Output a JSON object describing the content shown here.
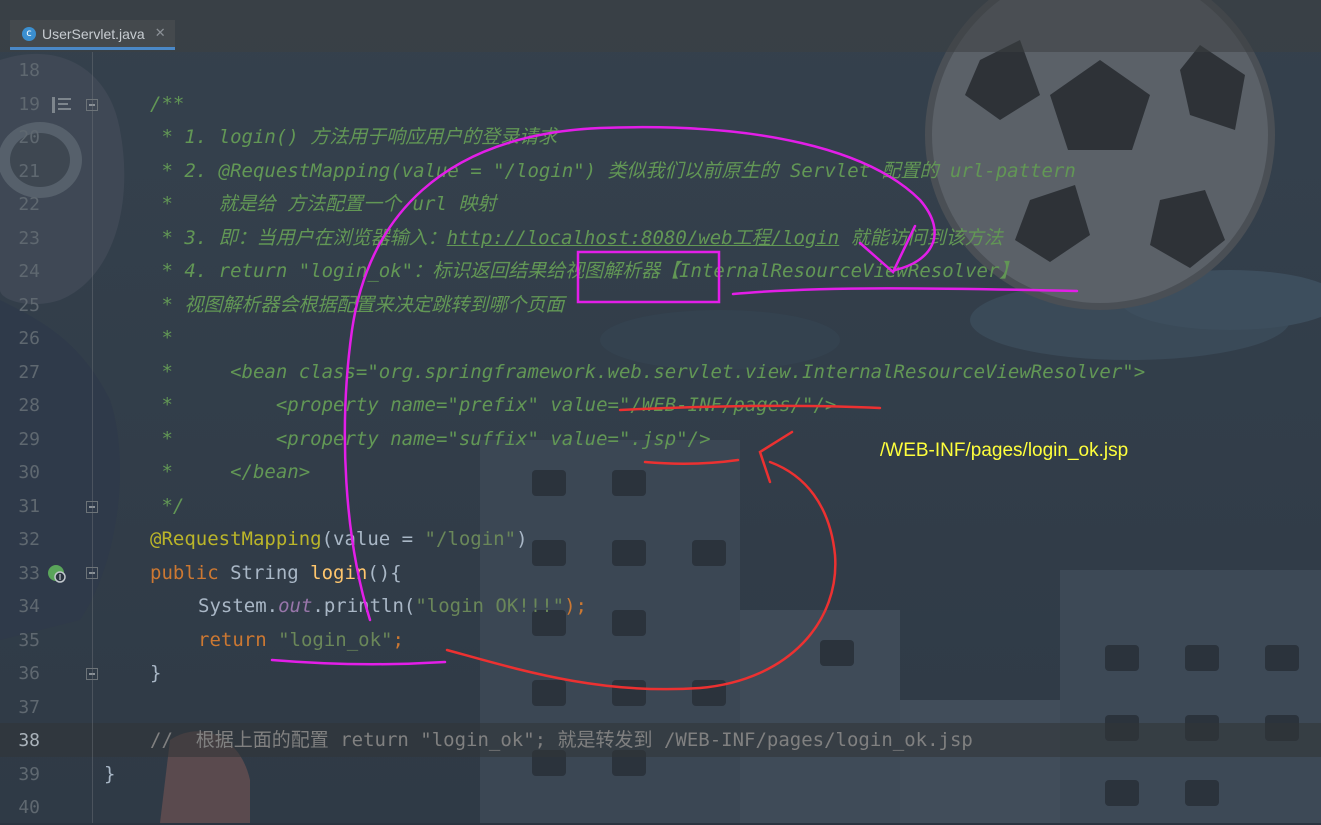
{
  "editor": {
    "tab": {
      "icon": "java-class-icon",
      "label": "UserServlet.java",
      "close": "✕"
    },
    "current_line": 38
  },
  "gutter": {
    "line_numbers": [
      "18",
      "19",
      "20",
      "21",
      "22",
      "23",
      "24",
      "25",
      "26",
      "27",
      "28",
      "29",
      "30",
      "31",
      "32",
      "33",
      "34",
      "35",
      "36",
      "37",
      "38",
      "39",
      "40"
    ]
  },
  "code": {
    "l19": "/**",
    "l20": " * 1. login() 方法用于响应用户的登录请求",
    "l21": " * 2. @RequestMapping(value = \"/login\") 类似我们以前原生的 Servlet 配置的 url-pattern",
    "l22": " *    就是给 方法配置一个 url 映射",
    "l23_pre": " * 3. 即：当用户在浏览器输入：",
    "l23_url": "http://localhost:8080/web工程/login",
    "l23_post": " 就能访问到该方法",
    "l24": " * 4. return \"login_ok\"：标识返回结果给视图解析器【InternalResourceViewResolver】",
    "l25": " * 视图解析器会根据配置来决定跳转到哪个页面",
    "l26": " *",
    "l27": " *     <bean class=\"org.springframework.web.servlet.view.InternalResourceViewResolver\">",
    "l28": " *         <property name=\"prefix\" value=\"/WEB-INF/pages/\"/>",
    "l29": " *         <property name=\"suffix\" value=\".jsp\"/>",
    "l30": " *     </bean>",
    "l31": " */",
    "l32_ann": "@RequestMapping",
    "l32_open": "(value = ",
    "l32_str": "\"/login\"",
    "l32_close": ")",
    "l33_kw": "public ",
    "l33_type": "String ",
    "l33_fn": "login",
    "l33_rest": "(){",
    "l34_a": "System.",
    "l34_field": "out",
    "l34_b": ".println(",
    "l34_str": "\"login OK!!!\"",
    "l34_c": ");",
    "l35_kw": "return ",
    "l35_str": "\"login_ok\"",
    "l35_semi": ";",
    "l36": "}",
    "l38": "//  根据上面的配置 return \"login_ok\"; 就是转发到 /WEB-INF/pages/login_ok.jsp",
    "l39": "}"
  },
  "annotation": {
    "note": "/WEB-INF/pages/login_ok.jsp",
    "colors": {
      "magenta": "#e31ee8",
      "red": "#ec3131",
      "note": "#ffff3c"
    }
  }
}
